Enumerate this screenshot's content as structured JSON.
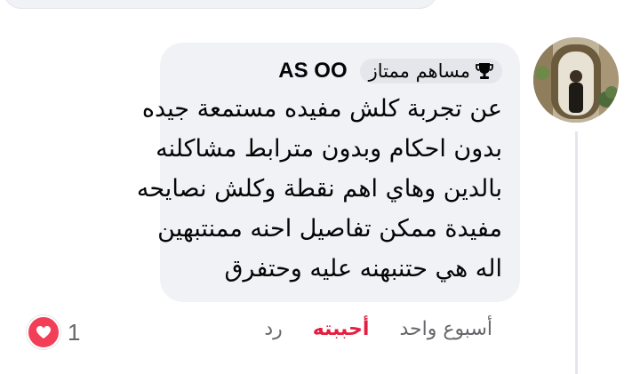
{
  "comment": {
    "author": "AS OO",
    "badge": {
      "label": "مساهم ممتاز",
      "icon": "trophy-icon"
    },
    "lines": [
      "عن تجربة كلش مفيده مستمعة جيده",
      "بدون احكام وبدون مترابط مشاكلنه",
      "بالدين وهاي اهم نقطة وكلش نصايحه",
      "مفيدة ممكن تفاصيل احنه ممنتبهين",
      "اله هي حتنبهنه عليه وحتفرق"
    ],
    "timestamp": "أسبوع واحد",
    "like_label": "أحببته",
    "reply_label": "رد",
    "reaction": {
      "icon": "heart-icon",
      "count": "1",
      "color": "#f33e58"
    }
  },
  "colors": {
    "bubble": "#f0f2f5",
    "like_active": "#e41e3f",
    "secondary_text": "#65676b"
  }
}
